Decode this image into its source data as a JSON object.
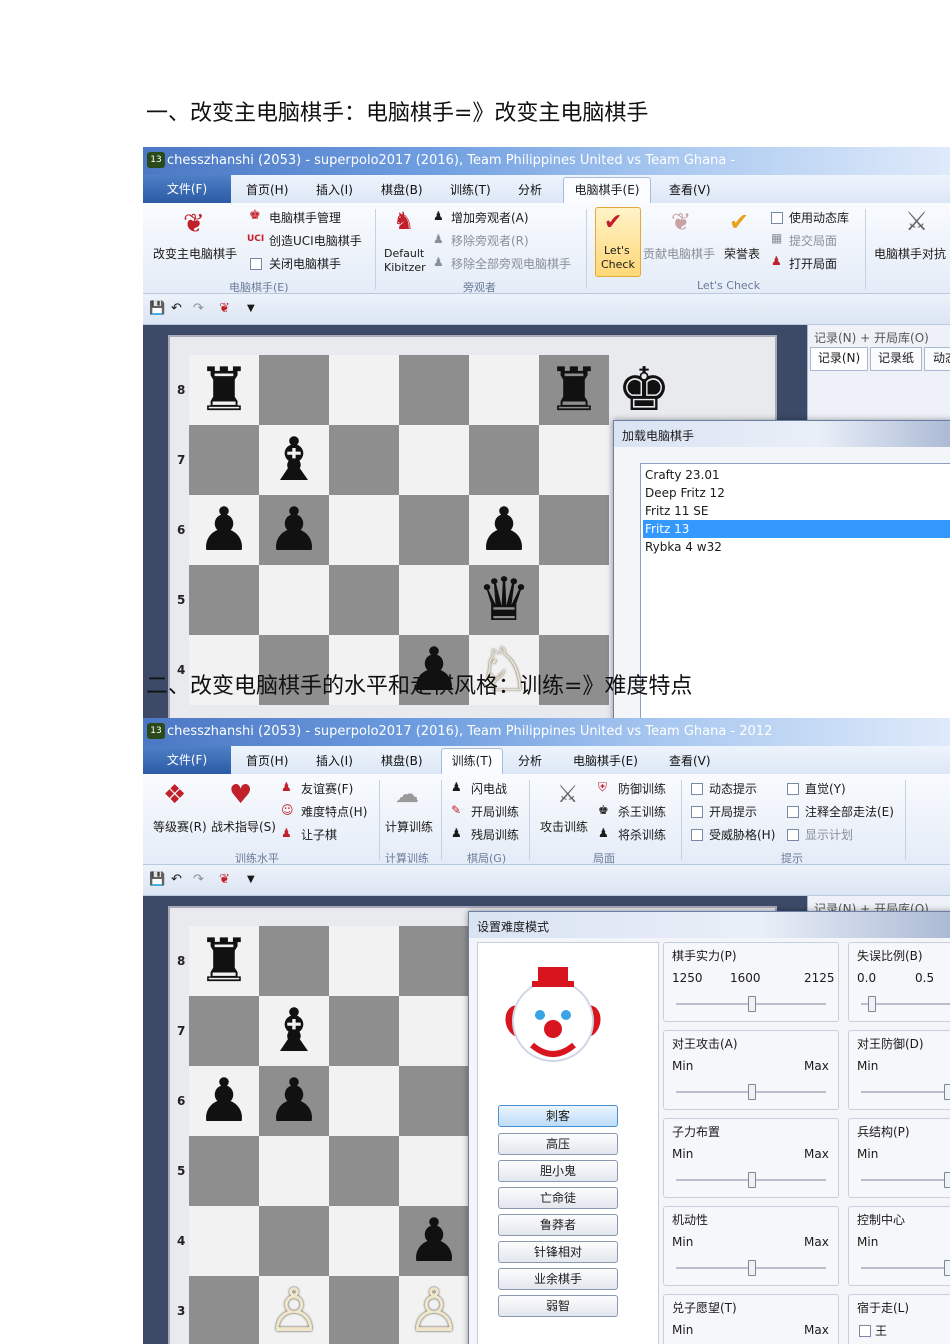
{
  "headings": {
    "h1": "一、改变主电脑棋手：电脑棋手=》改变主电脑棋手",
    "h2": "二、改变电脑棋手的水平和走棋风格：训练=》难度特点"
  },
  "window": {
    "title": "chesszhanshi (2053) - superpolo2017 (2016), Team Philippines United vs Team Ghana -",
    "title2": "chesszhanshi (2053) - superpolo2017 (2016), Team Philippines United vs Team Ghana - 2012",
    "app_icon": "13"
  },
  "menu": {
    "file": "文件(F)",
    "items": [
      "首页(H)",
      "插入(I)",
      "棋盘(B)",
      "训练(T)",
      "分析",
      "电脑棋手(E)",
      "查看(V)"
    ]
  },
  "ribbon1": {
    "change_engine": "改变主电脑棋手",
    "engine_mgmt": "电脑棋手管理",
    "create_uci": "创造UCI电脑棋手",
    "close_engine": "关闭电脑棋手",
    "group_engine": "电脑棋手(E)",
    "default_kibitzer_1": "Default",
    "default_kibitzer_2": "Kibitzer",
    "add_kibitzer": "增加旁观者(A)",
    "remove_kibitzer": "移除旁观者(R)",
    "remove_all_kibitzers": "移除全部旁观电脑棋手",
    "group_kibitzer": "旁观者",
    "lets_check_1": "Let's",
    "lets_check_2": "Check",
    "contribute": "贡献电脑棋手",
    "honor": "荣誉表",
    "use_dynamic": "使用动态库",
    "submit_position": "提交局面",
    "open_position": "打开局面",
    "group_letscheck": "Let's Check",
    "engine_match": "电脑棋手对抗"
  },
  "ribbon2": {
    "rated_games": "等级赛(R)",
    "tactics": "战术指导(S)",
    "friendly": "友谊赛(F)",
    "difficulty": "难度特点(H)",
    "handicap": "让子棋",
    "group_level": "训练水平",
    "calc_training": "计算训练",
    "group_calc": "计算训练",
    "blitz": "闪电战",
    "opening_training": "开局训练",
    "endgame_training": "残局训练",
    "group_game": "棋局(G)",
    "attack_training": "攻击训练",
    "defense_training": "防御训练",
    "king_kill": "杀王训练",
    "mate_training": "将杀训练",
    "group_position": "局面",
    "dynamic_hint": "动态提示",
    "opening_hint": "开局提示",
    "threat_hint": "受威胁格(H)",
    "intuition": "直觉(Y)",
    "annotate_all": "注释全部走法(E)",
    "show_plan": "显示计划",
    "group_hint": "提示"
  },
  "side_panel": {
    "header": "记录(N) + 开局库(O)",
    "tab_notation": "记录(N)",
    "tab_paper": "记录纸",
    "tab_dynamic": "动态"
  },
  "board": {
    "ranks": [
      "8",
      "7",
      "6",
      "5",
      "4"
    ],
    "ranks2": [
      "8",
      "7",
      "6",
      "5",
      "4",
      "3"
    ]
  },
  "load_dialog": {
    "title": "加载电脑棋手",
    "engines": [
      "Crafty 23.01",
      "Deep Fritz 12",
      "Fritz 11 SE",
      "Fritz 13",
      "Rybka 4 w32"
    ],
    "selected": "Fritz 13"
  },
  "difficulty_dialog": {
    "title": "设置难度模式",
    "styles": [
      "刺客",
      "高压",
      "胆小鬼",
      "亡命徒",
      "鲁莽者",
      "针锋相对",
      "业余棋手",
      "弱智"
    ],
    "selected_style": "刺客",
    "strength": {
      "label": "棋手实力(P)",
      "v1": "1250",
      "v2": "1600",
      "v3": "2125",
      "level": 0.5
    },
    "error_ratio": {
      "label": "失误比例(B)",
      "v1": "0.0",
      "v2": "0.5",
      "level": 0.1
    },
    "king_attack": {
      "label": "对王攻击(A)",
      "min": "Min",
      "max": "Max",
      "level": 0.5
    },
    "king_defense": {
      "label": "对王防御(D)",
      "min": "Min",
      "level": 0.9
    },
    "piece_placement": {
      "label": "子力布置",
      "min": "Min",
      "max": "Max",
      "level": 0.5
    },
    "pawn_structure": {
      "label": "兵结构(P)",
      "min": "Min",
      "level": 0.9
    },
    "mobility": {
      "label": "机动性",
      "min": "Min",
      "max": "Max",
      "level": 0.5
    },
    "center_control": {
      "label": "控制中心",
      "min": "Min",
      "level": 0.9
    },
    "sacrifice": {
      "label": "兑子愿望(T)",
      "min": "Min",
      "max": "Max"
    },
    "prefer": {
      "label": "宿于走(L)",
      "king_check": "王"
    }
  }
}
